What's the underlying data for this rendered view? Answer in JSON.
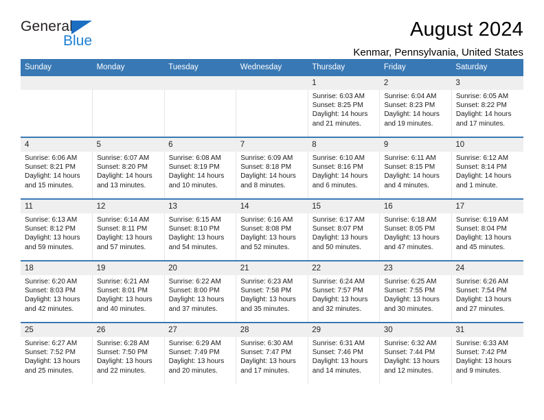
{
  "brand": {
    "name_top": "General",
    "name_bottom": "Blue",
    "accent_color": "#1b7fd4",
    "triangle_color": "#1b6ec2"
  },
  "header": {
    "title": "August 2024",
    "subtitle": "Kenmar, Pennsylvania, United States"
  },
  "theme": {
    "header_row_bg": "#3878b4",
    "daynum_bg": "#efefef",
    "cell_bg": "#ffffff",
    "divider": "#e4e4e4",
    "text": "#1a1a1a"
  },
  "weekday_headers": [
    "Sunday",
    "Monday",
    "Tuesday",
    "Wednesday",
    "Thursday",
    "Friday",
    "Saturday"
  ],
  "labels": {
    "sunrise_prefix": "Sunrise:",
    "sunset_prefix": "Sunset:",
    "daylight_prefix": "Daylight:"
  },
  "weeks": [
    {
      "days": [
        {
          "num": "",
          "empty": true
        },
        {
          "num": "",
          "empty": true
        },
        {
          "num": "",
          "empty": true
        },
        {
          "num": "",
          "empty": true
        },
        {
          "num": "1",
          "sunrise": "Sunrise: 6:03 AM",
          "sunset": "Sunset: 8:25 PM",
          "daylight1": "Daylight: 14 hours",
          "daylight2": "and 21 minutes."
        },
        {
          "num": "2",
          "sunrise": "Sunrise: 6:04 AM",
          "sunset": "Sunset: 8:23 PM",
          "daylight1": "Daylight: 14 hours",
          "daylight2": "and 19 minutes."
        },
        {
          "num": "3",
          "sunrise": "Sunrise: 6:05 AM",
          "sunset": "Sunset: 8:22 PM",
          "daylight1": "Daylight: 14 hours",
          "daylight2": "and 17 minutes."
        }
      ]
    },
    {
      "days": [
        {
          "num": "4",
          "sunrise": "Sunrise: 6:06 AM",
          "sunset": "Sunset: 8:21 PM",
          "daylight1": "Daylight: 14 hours",
          "daylight2": "and 15 minutes."
        },
        {
          "num": "5",
          "sunrise": "Sunrise: 6:07 AM",
          "sunset": "Sunset: 8:20 PM",
          "daylight1": "Daylight: 14 hours",
          "daylight2": "and 13 minutes."
        },
        {
          "num": "6",
          "sunrise": "Sunrise: 6:08 AM",
          "sunset": "Sunset: 8:19 PM",
          "daylight1": "Daylight: 14 hours",
          "daylight2": "and 10 minutes."
        },
        {
          "num": "7",
          "sunrise": "Sunrise: 6:09 AM",
          "sunset": "Sunset: 8:18 PM",
          "daylight1": "Daylight: 14 hours",
          "daylight2": "and 8 minutes."
        },
        {
          "num": "8",
          "sunrise": "Sunrise: 6:10 AM",
          "sunset": "Sunset: 8:16 PM",
          "daylight1": "Daylight: 14 hours",
          "daylight2": "and 6 minutes."
        },
        {
          "num": "9",
          "sunrise": "Sunrise: 6:11 AM",
          "sunset": "Sunset: 8:15 PM",
          "daylight1": "Daylight: 14 hours",
          "daylight2": "and 4 minutes."
        },
        {
          "num": "10",
          "sunrise": "Sunrise: 6:12 AM",
          "sunset": "Sunset: 8:14 PM",
          "daylight1": "Daylight: 14 hours",
          "daylight2": "and 1 minute."
        }
      ]
    },
    {
      "days": [
        {
          "num": "11",
          "sunrise": "Sunrise: 6:13 AM",
          "sunset": "Sunset: 8:12 PM",
          "daylight1": "Daylight: 13 hours",
          "daylight2": "and 59 minutes."
        },
        {
          "num": "12",
          "sunrise": "Sunrise: 6:14 AM",
          "sunset": "Sunset: 8:11 PM",
          "daylight1": "Daylight: 13 hours",
          "daylight2": "and 57 minutes."
        },
        {
          "num": "13",
          "sunrise": "Sunrise: 6:15 AM",
          "sunset": "Sunset: 8:10 PM",
          "daylight1": "Daylight: 13 hours",
          "daylight2": "and 54 minutes."
        },
        {
          "num": "14",
          "sunrise": "Sunrise: 6:16 AM",
          "sunset": "Sunset: 8:08 PM",
          "daylight1": "Daylight: 13 hours",
          "daylight2": "and 52 minutes."
        },
        {
          "num": "15",
          "sunrise": "Sunrise: 6:17 AM",
          "sunset": "Sunset: 8:07 PM",
          "daylight1": "Daylight: 13 hours",
          "daylight2": "and 50 minutes."
        },
        {
          "num": "16",
          "sunrise": "Sunrise: 6:18 AM",
          "sunset": "Sunset: 8:05 PM",
          "daylight1": "Daylight: 13 hours",
          "daylight2": "and 47 minutes."
        },
        {
          "num": "17",
          "sunrise": "Sunrise: 6:19 AM",
          "sunset": "Sunset: 8:04 PM",
          "daylight1": "Daylight: 13 hours",
          "daylight2": "and 45 minutes."
        }
      ]
    },
    {
      "days": [
        {
          "num": "18",
          "sunrise": "Sunrise: 6:20 AM",
          "sunset": "Sunset: 8:03 PM",
          "daylight1": "Daylight: 13 hours",
          "daylight2": "and 42 minutes."
        },
        {
          "num": "19",
          "sunrise": "Sunrise: 6:21 AM",
          "sunset": "Sunset: 8:01 PM",
          "daylight1": "Daylight: 13 hours",
          "daylight2": "and 40 minutes."
        },
        {
          "num": "20",
          "sunrise": "Sunrise: 6:22 AM",
          "sunset": "Sunset: 8:00 PM",
          "daylight1": "Daylight: 13 hours",
          "daylight2": "and 37 minutes."
        },
        {
          "num": "21",
          "sunrise": "Sunrise: 6:23 AM",
          "sunset": "Sunset: 7:58 PM",
          "daylight1": "Daylight: 13 hours",
          "daylight2": "and 35 minutes."
        },
        {
          "num": "22",
          "sunrise": "Sunrise: 6:24 AM",
          "sunset": "Sunset: 7:57 PM",
          "daylight1": "Daylight: 13 hours",
          "daylight2": "and 32 minutes."
        },
        {
          "num": "23",
          "sunrise": "Sunrise: 6:25 AM",
          "sunset": "Sunset: 7:55 PM",
          "daylight1": "Daylight: 13 hours",
          "daylight2": "and 30 minutes."
        },
        {
          "num": "24",
          "sunrise": "Sunrise: 6:26 AM",
          "sunset": "Sunset: 7:54 PM",
          "daylight1": "Daylight: 13 hours",
          "daylight2": "and 27 minutes."
        }
      ]
    },
    {
      "days": [
        {
          "num": "25",
          "sunrise": "Sunrise: 6:27 AM",
          "sunset": "Sunset: 7:52 PM",
          "daylight1": "Daylight: 13 hours",
          "daylight2": "and 25 minutes."
        },
        {
          "num": "26",
          "sunrise": "Sunrise: 6:28 AM",
          "sunset": "Sunset: 7:50 PM",
          "daylight1": "Daylight: 13 hours",
          "daylight2": "and 22 minutes."
        },
        {
          "num": "27",
          "sunrise": "Sunrise: 6:29 AM",
          "sunset": "Sunset: 7:49 PM",
          "daylight1": "Daylight: 13 hours",
          "daylight2": "and 20 minutes."
        },
        {
          "num": "28",
          "sunrise": "Sunrise: 6:30 AM",
          "sunset": "Sunset: 7:47 PM",
          "daylight1": "Daylight: 13 hours",
          "daylight2": "and 17 minutes."
        },
        {
          "num": "29",
          "sunrise": "Sunrise: 6:31 AM",
          "sunset": "Sunset: 7:46 PM",
          "daylight1": "Daylight: 13 hours",
          "daylight2": "and 14 minutes."
        },
        {
          "num": "30",
          "sunrise": "Sunrise: 6:32 AM",
          "sunset": "Sunset: 7:44 PM",
          "daylight1": "Daylight: 13 hours",
          "daylight2": "and 12 minutes."
        },
        {
          "num": "31",
          "sunrise": "Sunrise: 6:33 AM",
          "sunset": "Sunset: 7:42 PM",
          "daylight1": "Daylight: 13 hours",
          "daylight2": "and 9 minutes."
        }
      ]
    }
  ]
}
